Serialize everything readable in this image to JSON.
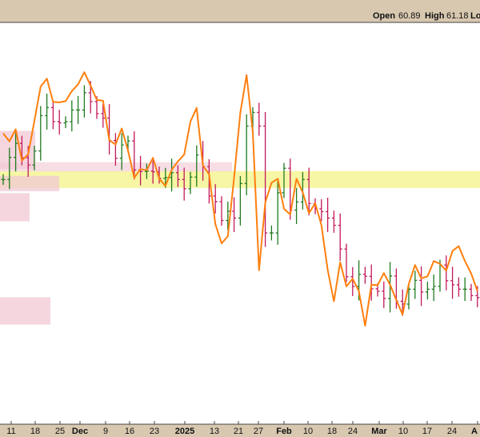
{
  "header": {
    "open_label": "Open",
    "open_value": "60.89",
    "high_label": "High",
    "high_value": "61.18",
    "low_label_partial": "Lo"
  },
  "colors": {
    "frame_bg": "#d8c8b0",
    "plot_bg": "#ffffff",
    "up_bar": "#1f7a1f",
    "down_bar": "#c2185b",
    "moving_average": "#ff7f0e",
    "yellow_zone": "#f5f5a0",
    "pink_zone": "#f2c8d4"
  },
  "chart_data": {
    "type": "ohlc",
    "overlay": "moving-average line",
    "grid": false,
    "x_tick_labels": [
      "11",
      "18",
      "25",
      "Dec",
      "9",
      "16",
      "23",
      "2025",
      "13",
      "21",
      "27",
      "Feb",
      "10",
      "18",
      "24",
      "Mar",
      "10",
      "17",
      "24",
      "A"
    ],
    "x_tick_bold": [
      "Dec",
      "2025",
      "Feb",
      "Mar",
      "A"
    ],
    "ylim": [
      0,
      100
    ],
    "y_note": "relative price scale (no y-axis labels visible)",
    "price_series": [
      60.9,
      66.4,
      69.9,
      66.3,
      64.5,
      68.0,
      76.8,
      78.8,
      75.3,
      75.0,
      75.3,
      78.2,
      78.2,
      82.5,
      80.3,
      77.3,
      76.2,
      70.6,
      66.2,
      69.5,
      70.5,
      63.3,
      62.9,
      63.0,
      62.8,
      61.2,
      61.4,
      62.6,
      60.9,
      58.6,
      61.5,
      67.0,
      64.1,
      56.8,
      55.4,
      50.7,
      53.0,
      51.3,
      59.9,
      74.2,
      77.6,
      74.2,
      47.6,
      47.6,
      57.6,
      63.7,
      53.3,
      55.3,
      60.9,
      54.9,
      53.6,
      52.9,
      51.3,
      49.5,
      43.6,
      36.7,
      34.3,
      37.3,
      36.8,
      33.7,
      33.1,
      31.3,
      36.9,
      30.6,
      29.9,
      33.6,
      35.8,
      32.9,
      33.6,
      34.3,
      39.6,
      35.7,
      34.7,
      33.6,
      33.6,
      32.0,
      31.5
    ],
    "moving_average": [
      72.4,
      70.4,
      73.4,
      65.6,
      67.2,
      75.5,
      84.0,
      86.0,
      80.2,
      80.1,
      80.4,
      82.9,
      84.6,
      87.6,
      84.3,
      80.7,
      80.5,
      70.7,
      69.6,
      73.6,
      68.1,
      61.3,
      63.5,
      63.2,
      66.3,
      61.1,
      59.3,
      63.3,
      65.4,
      67.1,
      75.3,
      78.7,
      64.4,
      62.2,
      49.8,
      45.0,
      46.8,
      61.3,
      77.5,
      86.9,
      72.7,
      38.3,
      55.2,
      60.1,
      61.1,
      53.6,
      52.2,
      61.1,
      57.7,
      52.5,
      55.0,
      49.5,
      38.4,
      30.6,
      40.3,
      34.3,
      36.2,
      33.1,
      24.5,
      34.7,
      34.6,
      37.6,
      34.7,
      30.9,
      27.3,
      34.9,
      39.6,
      36.3,
      36.8,
      40.6,
      39.9,
      38.2,
      43.1,
      44.3,
      40.6,
      37.5,
      33.1
    ]
  },
  "zones": [
    {
      "name": "yellow-resistance-zone",
      "from": 58.8,
      "to": 63.0
    },
    {
      "name": "pink-zone-1",
      "from": 63.5,
      "to": 73.0
    },
    {
      "name": "pink-zone-2",
      "from": 58.0,
      "to": 61.8
    },
    {
      "name": "pink-zone-3",
      "from": 50.5,
      "to": 57.5
    },
    {
      "name": "pink-zone-4",
      "from": 24.8,
      "to": 31.6
    }
  ]
}
